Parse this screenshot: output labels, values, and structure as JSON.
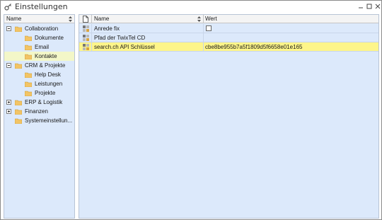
{
  "window": {
    "title": "Einstellungen"
  },
  "tree": {
    "header": "Name",
    "items": [
      {
        "label": "Collaboration",
        "level": 0,
        "expander": "minus"
      },
      {
        "label": "Dokumente",
        "level": 1
      },
      {
        "label": "Email",
        "level": 1
      },
      {
        "label": "Kontakte",
        "level": 1,
        "selected": true
      },
      {
        "label": "CRM & Projekte",
        "level": 0,
        "expander": "minus"
      },
      {
        "label": "Help Desk",
        "level": 1
      },
      {
        "label": "Leistungen",
        "level": 1
      },
      {
        "label": "Projekte",
        "level": 1
      },
      {
        "label": "ERP & Logistik",
        "level": 0,
        "expander": "plus"
      },
      {
        "label": "Finanzen",
        "level": 0,
        "expander": "plus"
      },
      {
        "label": "Systemeinstellun...",
        "level": 0
      }
    ]
  },
  "grid": {
    "columns": {
      "name": "Name",
      "value": "Wert"
    },
    "rows": [
      {
        "name": "Anrede fix",
        "value": "",
        "checkbox": true
      },
      {
        "name": "Pfad der TwixTel CD",
        "value": ""
      },
      {
        "name": "search.ch API Schlüssel",
        "value": "cbe8be955b7a5f1809d5f6658e01e165",
        "highlight": true
      }
    ]
  },
  "colors": {
    "panel_bg": "#dce9fb",
    "selected_tree": "#f3f7c8",
    "highlight_row": "#fdf58a",
    "folder": "#f2c466"
  }
}
